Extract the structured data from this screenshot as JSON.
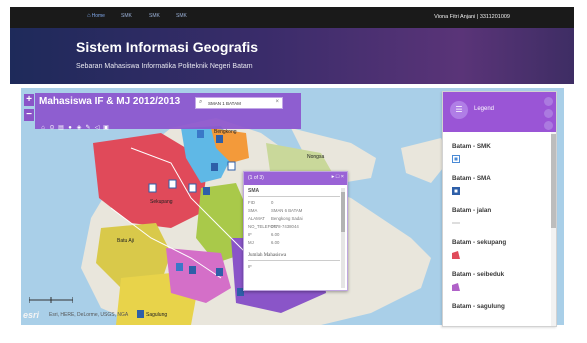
{
  "nav": {
    "home": "Home",
    "items": [
      "SMK",
      "SMK",
      "SMK"
    ],
    "user": "Viona Fitri Anjani | 3311201009"
  },
  "banner": {
    "title": "Sistem Informasi Geografis",
    "subtitle": "Sebaran Mahasiswa Informatika Politeknik Negeri Batam"
  },
  "map": {
    "layer_title": "Mahasiswa IF & MJ 2012/2013",
    "search_value": "SMAN 1 BATAM",
    "zoom_in": "+",
    "zoom_out": "−",
    "labels": [
      "Bengkong",
      "Sekupang",
      "Nongsa",
      "Batu Aji",
      "Sagulung"
    ],
    "attribution": "Esri, HERE, DeLorme, USGS, NGA",
    "esri_logo": "esri",
    "tools": [
      "home-icon",
      "zoom-icon",
      "layers-icon",
      "search-icon",
      "measure-icon",
      "edit-icon",
      "share-icon",
      "print-icon"
    ]
  },
  "popup": {
    "count": "(1 of 3)",
    "layer": "SMA",
    "fields": [
      {
        "key": "FID",
        "value": "0"
      },
      {
        "key": "SMA",
        "value": "SMAN 6 BATAM"
      },
      {
        "key": "ALAMAT",
        "value": "Bengkong Sadai"
      },
      {
        "key": "NO_TELEFON",
        "value": "0778-7438044"
      },
      {
        "key": "IF",
        "value": "6.00"
      },
      {
        "key": "MJ",
        "value": "6.00"
      }
    ],
    "section": "Jumlah Mahasiswa",
    "section_detail": "IF"
  },
  "legend": {
    "title": "Legend",
    "items": [
      {
        "label": "Batam - SMK",
        "swatch": "#4a8ad6"
      },
      {
        "label": "Batam - SMA",
        "swatch": "#2e5fa8"
      },
      {
        "label": "Batam - jalan",
        "swatch": "#bdbdbd"
      },
      {
        "label": "Batam - sekupang",
        "swatch": "#e04a5a"
      },
      {
        "label": "Batam - seibeduk",
        "swatch": "#b062c8"
      },
      {
        "label": "Batam - sagulung",
        "swatch": "#d4c43c"
      }
    ]
  },
  "colors": {
    "accent": "#9a55d6",
    "nav_bg": "#1a1a1a",
    "sea": "#a9cfe8",
    "land": "#e9e6dc"
  }
}
